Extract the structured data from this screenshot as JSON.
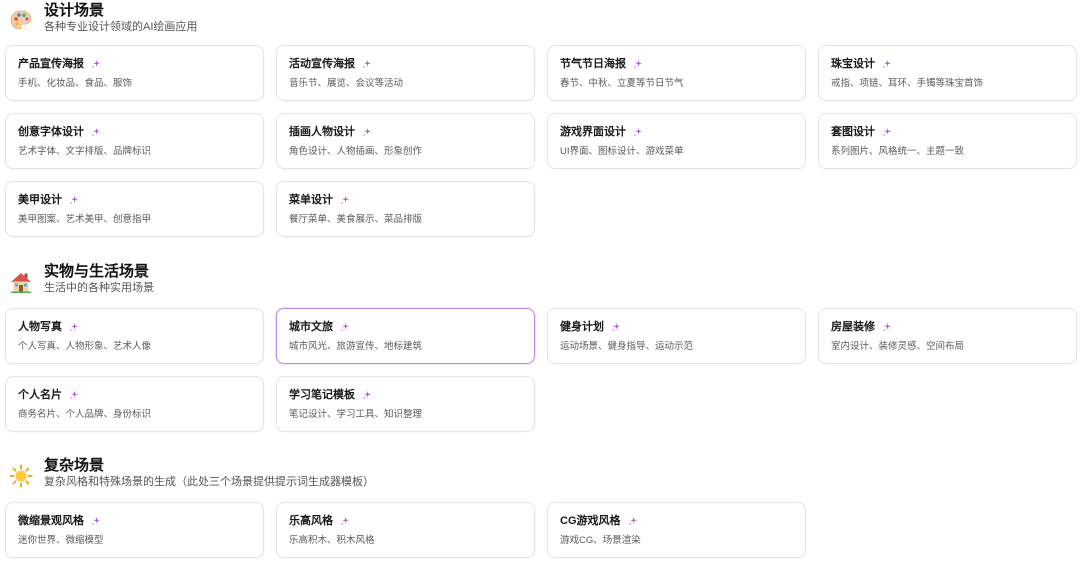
{
  "colors": {
    "accent": "#b04fe0",
    "active_border": "#c58ce6"
  },
  "sections": [
    {
      "icon": "palette-icon",
      "title": "设计场景",
      "subtitle": "各种专业设计领域的AI绘画应用",
      "cards": [
        {
          "title": "产品宣传海报",
          "desc": "手机、化妆品、食品、服饰"
        },
        {
          "title": "活动宣传海报",
          "desc": "音乐节、展览、会议等活动"
        },
        {
          "title": "节气节日海报",
          "desc": "春节、中秋、立夏等节日节气"
        },
        {
          "title": "珠宝设计",
          "desc": "戒指、项链、耳环、手镯等珠宝首饰"
        },
        {
          "title": "创意字体设计",
          "desc": "艺术字体、文字排版、品牌标识"
        },
        {
          "title": "插画人物设计",
          "desc": "角色设计、人物插画、形象创作"
        },
        {
          "title": "游戏界面设计",
          "desc": "UI界面、图标设计、游戏菜单"
        },
        {
          "title": "套图设计",
          "desc": "系列图片、风格统一、主题一致"
        },
        {
          "title": "美甲设计",
          "desc": "美甲图案、艺术美甲、创意指甲"
        },
        {
          "title": "菜单设计",
          "desc": "餐厅菜单、美食展示、菜品排版"
        }
      ]
    },
    {
      "icon": "house-icon",
      "title": "实物与生活场景",
      "subtitle": "生活中的各种实用场景",
      "cards": [
        {
          "title": "人物写真",
          "desc": "个人写真、人物形象、艺术人像"
        },
        {
          "title": "城市文旅",
          "desc": "城市风光、旅游宣传、地标建筑"
        },
        {
          "title": "健身计划",
          "desc": "运动场景、健身指导、运动示范"
        },
        {
          "title": "房屋装修",
          "desc": "室内设计、装修灵感、空间布局"
        },
        {
          "title": "个人名片",
          "desc": "商务名片、个人品牌、身份标识"
        },
        {
          "title": "学习笔记模板",
          "desc": "笔记设计、学习工具、知识整理"
        }
      ]
    },
    {
      "icon": "sun-icon",
      "title": "复杂场景",
      "subtitle": "复杂风格和特殊场景的生成（此处三个场景提供提示词生成器模板）",
      "cards": [
        {
          "title": "微缩景观风格",
          "desc": "迷你世界、微缩模型"
        },
        {
          "title": "乐高风格",
          "desc": "乐高积木、积木风格"
        },
        {
          "title": "CG游戏风格",
          "desc": "游戏CG、场景渲染"
        }
      ]
    }
  ],
  "active_card": "城市文旅"
}
